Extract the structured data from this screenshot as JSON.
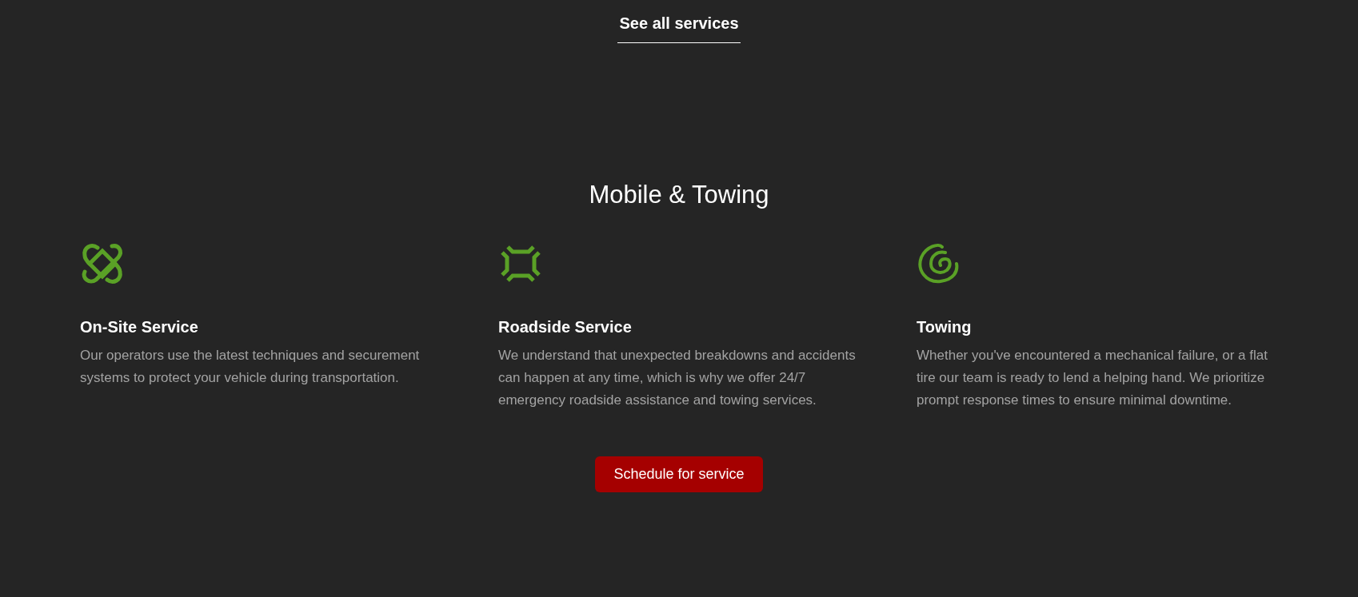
{
  "top_link": "See all services",
  "section": {
    "title": "Mobile & Towing",
    "services": [
      {
        "kind": "knot",
        "title": "On-Site Service",
        "description": "Our operators use the latest techniques and securement systems to protect your vehicle during transportation."
      },
      {
        "kind": "frame",
        "title": "Roadside Service",
        "description": "We understand that unexpected breakdowns and accidents can happen at any time, which is why we offer 24/7 emergency roadside assistance and towing services."
      },
      {
        "kind": "spiral",
        "title": "Towing",
        "description": "Whether you've encountered a mechanical failure, or a flat tire our team is ready to lend a helping hand. We prioritize prompt response times to ensure minimal downtime."
      }
    ],
    "button": "Schedule for service"
  }
}
